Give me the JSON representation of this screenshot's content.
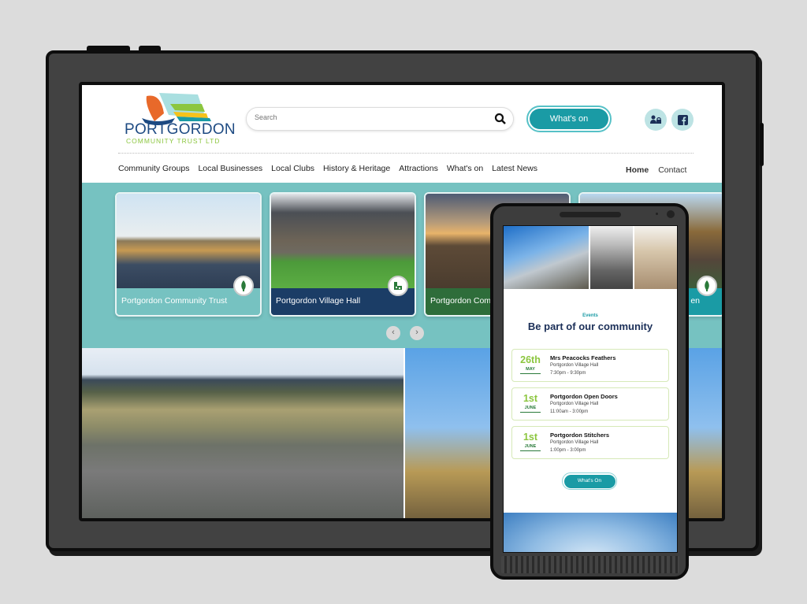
{
  "brand": {
    "name": "PORTGORDON",
    "tagline": "COMMUNITY TRUST LTD",
    "colors": {
      "teal": "#1a9ba5",
      "navy": "#1b2f58",
      "green": "#8cc63f",
      "band": "#76c2c1",
      "orange": "#e8692a"
    }
  },
  "header": {
    "search_placeholder": "Search",
    "search_icon": "search-icon",
    "whats_on_label": "What's on",
    "account_icon": "user-lock-icon",
    "facebook_icon": "facebook-icon"
  },
  "nav": {
    "items": [
      "Community Groups",
      "Local Businesses",
      "Local Clubs",
      "History & Heritage",
      "Attractions",
      "What's on",
      "Latest News"
    ],
    "right": [
      "Home",
      "Contact"
    ],
    "active": "Home"
  },
  "carousel": {
    "cards": [
      {
        "label": "Portgordon Community Trust",
        "icon": "tree-icon",
        "color": "#76c2c1"
      },
      {
        "label": "Portgordon Village Hall",
        "icon": "building-icon",
        "color": "#1b3d66"
      },
      {
        "label": "Portgordon Comm",
        "icon": "",
        "color": "#2e6d3a"
      },
      {
        "label": "en",
        "icon": "tree-icon",
        "color": "#1a9ba5"
      }
    ],
    "prev_icon": "chevron-left-icon",
    "next_icon": "chevron-right-icon"
  },
  "mobile": {
    "events_kicker": "Events",
    "events_title": "Be part of our community",
    "events": [
      {
        "day": "26th",
        "month": "MAY",
        "name": "Mrs Peacocks Feathers",
        "location": "Portgordon Village Hall",
        "time": "7:30pm - 9:30pm"
      },
      {
        "day": "1st",
        "month": "JUNE",
        "name": "Portgordon Open Doors",
        "location": "Portgordon Village Hall",
        "time": "11:00am - 3:00pm"
      },
      {
        "day": "1st",
        "month": "JUNE",
        "name": "Portgordon Stitchers",
        "location": "Portgordon Village Hall",
        "time": "1:00pm - 3:00pm"
      }
    ],
    "button_label": "What's On"
  }
}
